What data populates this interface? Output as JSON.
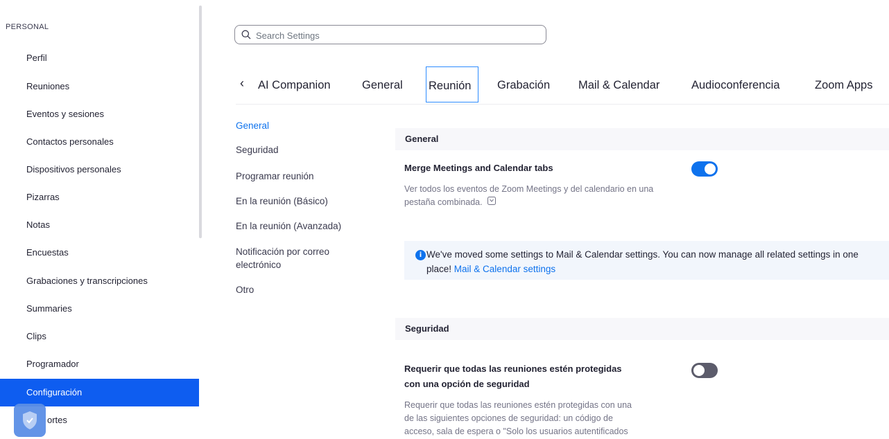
{
  "sidebar": {
    "section_label": "PERSONAL",
    "items": [
      {
        "label": "Perfil"
      },
      {
        "label": "Reuniones"
      },
      {
        "label": "Eventos y sesiones"
      },
      {
        "label": "Contactos personales"
      },
      {
        "label": "Dispositivos personales"
      },
      {
        "label": "Pizarras"
      },
      {
        "label": "Notas"
      },
      {
        "label": "Encuestas"
      },
      {
        "label": "Grabaciones y transcripciones"
      },
      {
        "label": "Summaries"
      },
      {
        "label": "Clips"
      },
      {
        "label": "Programador"
      },
      {
        "label": "Configuración",
        "active": true
      },
      {
        "label": "ortes",
        "partially_obscured": true
      }
    ]
  },
  "search": {
    "placeholder": "Search Settings",
    "value": ""
  },
  "tabs": {
    "prev_icon": "chevron-left-icon",
    "items": [
      {
        "label": "AI Companion"
      },
      {
        "label": "General"
      },
      {
        "label": "Reunión",
        "active": true
      },
      {
        "label": "Grabación"
      },
      {
        "label": "Mail & Calendar"
      },
      {
        "label": "Audioconferencia"
      },
      {
        "label": "Zoom Apps"
      }
    ]
  },
  "subnav": {
    "items": [
      {
        "label": "General",
        "active": true
      },
      {
        "label": "Seguridad"
      },
      {
        "label": "Programar reunión"
      },
      {
        "label": "En la reunión (Básico)"
      },
      {
        "label": "En la reunión (Avanzada)"
      },
      {
        "label": "Notificación por correo electrónico"
      },
      {
        "label": "Otro"
      }
    ]
  },
  "sections": {
    "general": {
      "title": "General",
      "merge_setting": {
        "title": "Merge Meetings and Calendar tabs",
        "description": "Ver todos los eventos de Zoom Meetings y del calendario en una pestaña combinada.",
        "enabled": true
      },
      "banner": {
        "text": "We've moved some settings to Mail & Calendar settings. You can now manage all related settings in one place!",
        "link": "Mail & Calendar settings"
      }
    },
    "security": {
      "title": "Seguridad",
      "require_setting": {
        "title_line1": "Requerir que todas las reuniones estén protegidas",
        "title_line2": "con una opción de seguridad",
        "description_line1": "Requerir que todas las reuniones estén protegidas con una",
        "description_line2": "de las siguientes opciones de seguridad: un código de",
        "description_line3": "acceso, sala de espera o \"Solo los usuarios autentificados",
        "enabled": false
      }
    }
  },
  "colors": {
    "accent": "#0e5df0",
    "link": "#0e72ed",
    "toggle_off": "#5c5c6b"
  }
}
